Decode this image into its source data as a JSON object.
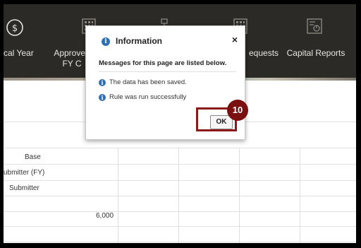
{
  "nav": {
    "items": [
      {
        "label": "cal Year",
        "icon": "dollar-circle-icon"
      },
      {
        "label": "Approved\nFY C",
        "icon": "grid-icon"
      },
      {
        "label": "",
        "icon": "org-chart-icon"
      },
      {
        "label": "equests",
        "icon": "grid-icon"
      },
      {
        "label": "Capital Reports",
        "icon": "report-icon"
      }
    ]
  },
  "table": {
    "rows": [
      {
        "label": "Base"
      },
      {
        "label": "ubmitter (FY)"
      },
      {
        "label": "Submitter"
      },
      {
        "label": ""
      },
      {
        "label": "6,000"
      }
    ]
  },
  "dialog": {
    "title": "Information",
    "close": "×",
    "header": "Messages for this page are listed below.",
    "messages": [
      "The data has been saved.",
      "Rule was run successfully"
    ],
    "ok_label": "OK"
  },
  "annotation": {
    "step": "10",
    "color": "#8b1a1a"
  }
}
